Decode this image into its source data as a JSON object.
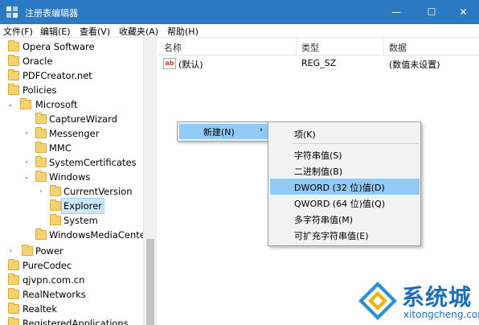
{
  "window": {
    "title": "注册表编辑器",
    "min_glyph": "—",
    "max_glyph": "☐",
    "close_glyph": "✕"
  },
  "menubar": [
    "文件(F)",
    "编辑(E)",
    "查看(V)",
    "收藏夹(A)",
    "帮助(H)"
  ],
  "tree": [
    {
      "label": "Opera Software"
    },
    {
      "label": "Oracle"
    },
    {
      "label": "PDFCreator.net"
    },
    {
      "label": "Policies"
    },
    {
      "label": "Microsoft"
    },
    {
      "label": "CaptureWizard"
    },
    {
      "label": "Messenger"
    },
    {
      "label": "MMC"
    },
    {
      "label": "SystemCertificates"
    },
    {
      "label": "Windows"
    },
    {
      "label": "CurrentVersion"
    },
    {
      "label": "Explorer",
      "selected": true
    },
    {
      "label": "System"
    },
    {
      "label": "WindowsMediaCenter"
    },
    {
      "label": "Power"
    },
    {
      "label": "PureCodec"
    },
    {
      "label": "qjvpn.com.cn"
    },
    {
      "label": "RealNetworks"
    },
    {
      "label": "Realtek"
    },
    {
      "label": "RegisteredApplications"
    }
  ],
  "list": {
    "columns": [
      "名称",
      "类型",
      "数据"
    ],
    "rows": [
      {
        "icon": "ab",
        "name": "(默认)",
        "type": "REG_SZ",
        "data": "(数值未设置)"
      }
    ]
  },
  "context_menu": {
    "new_label": "新建(N)",
    "arrow": "›"
  },
  "submenu": {
    "items": [
      "项(K)",
      "字符串值(S)",
      "二进制值(B)",
      "DWORD (32 位)值(D)",
      "QWORD (64 位)值(Q)",
      "多字符串值(M)",
      "可扩充字符串值(E)"
    ],
    "highlighted": "DWORD (32 位)值(D)"
  },
  "watermark": {
    "text": "系统城",
    "url": "xitongcheng.com"
  },
  "colors": {
    "titlebar": "#2b79c2",
    "menu_highlight": "#91c9f7",
    "selection": "#cce8ff",
    "watermark": "#1f6fb8"
  }
}
